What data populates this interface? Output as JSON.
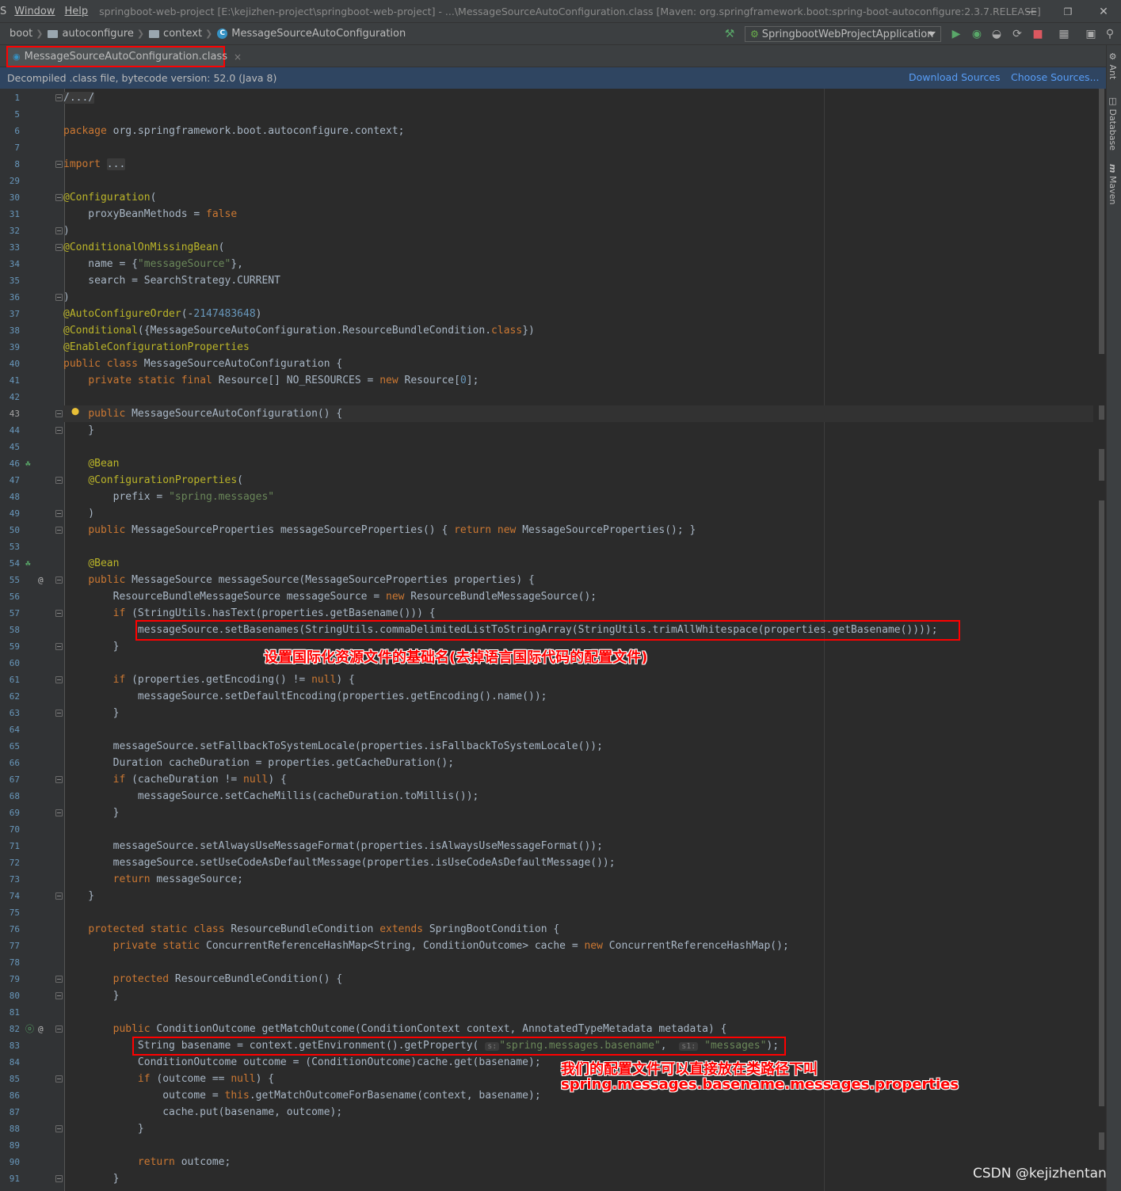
{
  "titlebar": {
    "menu_s": "S",
    "menu_window": "Window",
    "menu_help": "Help",
    "title": "springboot-web-project [E:\\kejizhen-project\\springboot-web-project] - ...\\MessageSourceAutoConfiguration.class [Maven: org.springframework.boot:spring-boot-autoconfigure:2.3.7.RELEASE]"
  },
  "breadcrumbs": [
    "boot",
    "autoconfigure",
    "context",
    "MessageSourceAutoConfiguration"
  ],
  "run_config": "SpringbootWebProjectApplication",
  "tab": {
    "label": "MessageSourceAutoConfiguration.class",
    "close": "×"
  },
  "infobar": {
    "text": "Decompiled .class file, bytecode version: 52.0 (Java 8)",
    "download_sources": "Download Sources",
    "choose_sources": "Choose Sources..."
  },
  "right_tools": [
    "Ant",
    "Database",
    "Maven"
  ],
  "notes": {
    "note1": "设置国际化资源文件的基础名(去掉语言国际代码的配置文件)",
    "note2_line1": "我们的配置文件可以直接放在类路径下叫",
    "note2_line2": "spring.messages.basename.messages.properties"
  },
  "hints": {
    "s": "s:",
    "s1": "s1:"
  },
  "watermark": "CSDN @kejizhentan",
  "code_lines": [
    {
      "n": "1",
      "t": "/.../"
    },
    {
      "n": "5",
      "t": ""
    },
    {
      "n": "6",
      "t": "package org.springframework.boot.autoconfigure.context;"
    },
    {
      "n": "7",
      "t": ""
    },
    {
      "n": "8",
      "t": "import ..."
    },
    {
      "n": "29",
      "t": ""
    },
    {
      "n": "30",
      "t": "@Configuration("
    },
    {
      "n": "31",
      "t": "    proxyBeanMethods = false"
    },
    {
      "n": "32",
      "t": ")"
    },
    {
      "n": "33",
      "t": "@ConditionalOnMissingBean("
    },
    {
      "n": "34",
      "t": "    name = {\"messageSource\"},"
    },
    {
      "n": "35",
      "t": "    search = SearchStrategy.CURRENT"
    },
    {
      "n": "36",
      "t": ")"
    },
    {
      "n": "37",
      "t": "@AutoConfigureOrder(-2147483648)"
    },
    {
      "n": "38",
      "t": "@Conditional({MessageSourceAutoConfiguration.ResourceBundleCondition.class})"
    },
    {
      "n": "39",
      "t": "@EnableConfigurationProperties"
    },
    {
      "n": "40",
      "t": "public class MessageSourceAutoConfiguration {"
    },
    {
      "n": "41",
      "t": "    private static final Resource[] NO_RESOURCES = new Resource[0];"
    },
    {
      "n": "42",
      "t": ""
    },
    {
      "n": "43",
      "t": "    public MessageSourceAutoConfiguration() {"
    },
    {
      "n": "44",
      "t": "    }"
    },
    {
      "n": "45",
      "t": ""
    },
    {
      "n": "46",
      "t": "    @Bean"
    },
    {
      "n": "47",
      "t": "    @ConfigurationProperties("
    },
    {
      "n": "48",
      "t": "        prefix = \"spring.messages\""
    },
    {
      "n": "49",
      "t": "    )"
    },
    {
      "n": "50",
      "t": "    public MessageSourceProperties messageSourceProperties() { return new MessageSourceProperties(); }"
    },
    {
      "n": "53",
      "t": ""
    },
    {
      "n": "54",
      "t": "    @Bean"
    },
    {
      "n": "55",
      "t": "    public MessageSource messageSource(MessageSourceProperties properties) {"
    },
    {
      "n": "56",
      "t": "        ResourceBundleMessageSource messageSource = new ResourceBundleMessageSource();"
    },
    {
      "n": "57",
      "t": "        if (StringUtils.hasText(properties.getBasename())) {"
    },
    {
      "n": "58",
      "t": "            messageSource.setBasenames(StringUtils.commaDelimitedListToStringArray(StringUtils.trimAllWhitespace(properties.getBasename())));"
    },
    {
      "n": "59",
      "t": "        }"
    },
    {
      "n": "60",
      "t": ""
    },
    {
      "n": "61",
      "t": "        if (properties.getEncoding() != null) {"
    },
    {
      "n": "62",
      "t": "            messageSource.setDefaultEncoding(properties.getEncoding().name());"
    },
    {
      "n": "63",
      "t": "        }"
    },
    {
      "n": "64",
      "t": ""
    },
    {
      "n": "65",
      "t": "        messageSource.setFallbackToSystemLocale(properties.isFallbackToSystemLocale());"
    },
    {
      "n": "66",
      "t": "        Duration cacheDuration = properties.getCacheDuration();"
    },
    {
      "n": "67",
      "t": "        if (cacheDuration != null) {"
    },
    {
      "n": "68",
      "t": "            messageSource.setCacheMillis(cacheDuration.toMillis());"
    },
    {
      "n": "69",
      "t": "        }"
    },
    {
      "n": "70",
      "t": ""
    },
    {
      "n": "71",
      "t": "        messageSource.setAlwaysUseMessageFormat(properties.isAlwaysUseMessageFormat());"
    },
    {
      "n": "72",
      "t": "        messageSource.setUseCodeAsDefaultMessage(properties.isUseCodeAsDefaultMessage());"
    },
    {
      "n": "73",
      "t": "        return messageSource;"
    },
    {
      "n": "74",
      "t": "    }"
    },
    {
      "n": "75",
      "t": ""
    },
    {
      "n": "76",
      "t": "    protected static class ResourceBundleCondition extends SpringBootCondition {"
    },
    {
      "n": "77",
      "t": "        private static ConcurrentReferenceHashMap<String, ConditionOutcome> cache = new ConcurrentReferenceHashMap();"
    },
    {
      "n": "78",
      "t": ""
    },
    {
      "n": "79",
      "t": "        protected ResourceBundleCondition() {"
    },
    {
      "n": "80",
      "t": "        }"
    },
    {
      "n": "81",
      "t": ""
    },
    {
      "n": "82",
      "t": "        public ConditionOutcome getMatchOutcome(ConditionContext context, AnnotatedTypeMetadata metadata) {"
    },
    {
      "n": "83",
      "t": "            String basename = context.getEnvironment().getProperty( s: \"spring.messages.basename\",  s1: \"messages\");"
    },
    {
      "n": "84",
      "t": "            ConditionOutcome outcome = (ConditionOutcome)cache.get(basename);"
    },
    {
      "n": "85",
      "t": "            if (outcome == null) {"
    },
    {
      "n": "86",
      "t": "                outcome = this.getMatchOutcomeForBasename(context, basename);"
    },
    {
      "n": "87",
      "t": "                cache.put(basename, outcome);"
    },
    {
      "n": "88",
      "t": "            }"
    },
    {
      "n": "89",
      "t": ""
    },
    {
      "n": "90",
      "t": "            return outcome;"
    },
    {
      "n": "91",
      "t": "        }"
    }
  ]
}
